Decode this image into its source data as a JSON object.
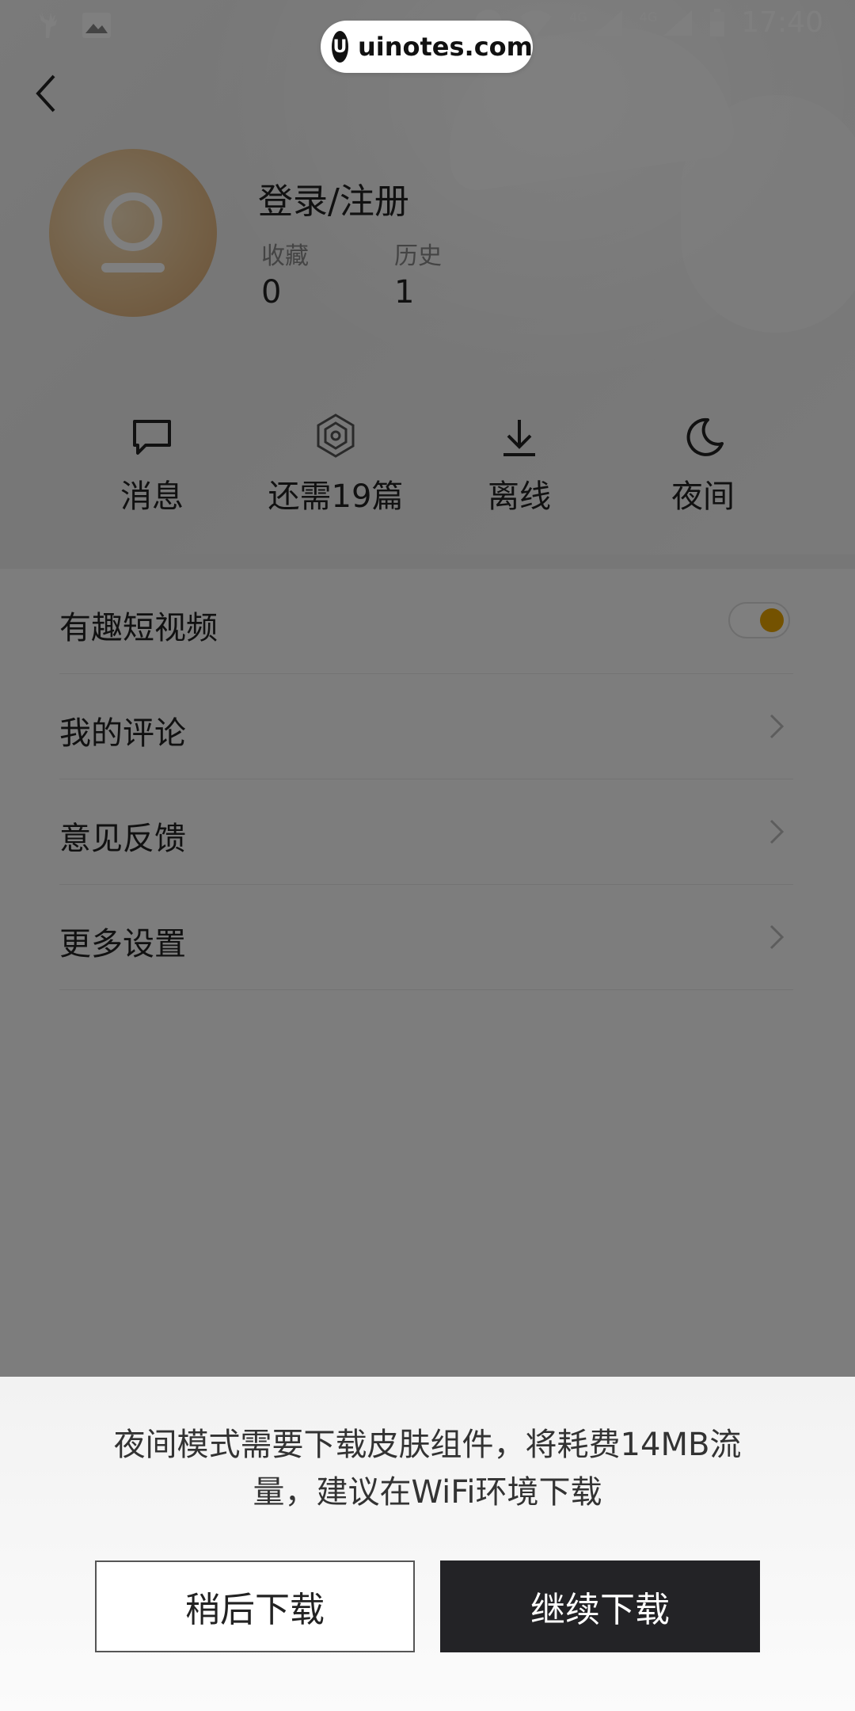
{
  "status_bar": {
    "time": "17:40",
    "net1": "4G",
    "net2": "4G"
  },
  "watermark": {
    "text": "uinotes.com",
    "logo": "U"
  },
  "profile": {
    "username": "登录/注册",
    "favorites_label": "收藏",
    "favorites_count": "0",
    "history_label": "历史",
    "history_count": "1"
  },
  "actions": [
    {
      "label": "消息",
      "icon": "message-icon"
    },
    {
      "label": "还需19篇",
      "icon": "hexagon-badge-icon"
    },
    {
      "label": "离线",
      "icon": "download-icon"
    },
    {
      "label": "夜间",
      "icon": "moon-icon"
    }
  ],
  "menu": [
    {
      "label": "有趣短视频",
      "control": "toggle",
      "toggle_on": true
    },
    {
      "label": "我的评论",
      "control": "chevron"
    },
    {
      "label": "意见反馈",
      "control": "chevron"
    },
    {
      "label": "更多设置",
      "control": "chevron"
    }
  ],
  "dialog": {
    "message": "夜间模式需要下载皮肤组件，将耗费14MB流量，建议在WiFi环境下载",
    "later_label": "稍后下载",
    "continue_label": "继续下载"
  },
  "colors": {
    "toggle_accent": "#e9a400",
    "primary_button": "#232326",
    "overlay": "rgba(0,0,0,0.5)"
  }
}
